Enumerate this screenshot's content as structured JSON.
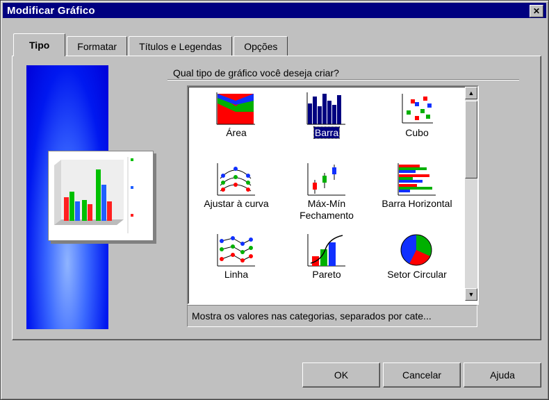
{
  "window": {
    "title": "Modificar Gráfico",
    "close_glyph": "✕"
  },
  "tabs": [
    {
      "label": "Tipo",
      "active": true
    },
    {
      "label": "Formatar",
      "active": false
    },
    {
      "label": "Títulos e Legendas",
      "active": false
    },
    {
      "label": "Opções",
      "active": false
    }
  ],
  "prompt": "Qual tipo de gráfico você deseja criar?",
  "chart_types": [
    {
      "label": "Área",
      "icon": "area-chart-icon",
      "selected": false
    },
    {
      "label": "Barra",
      "icon": "bar-chart-icon",
      "selected": true
    },
    {
      "label": "Cubo",
      "icon": "cube-chart-icon",
      "selected": false
    },
    {
      "label": "Ajustar à curva",
      "icon": "curve-fit-chart-icon",
      "selected": false
    },
    {
      "label": "Máx-Mín Fechamento",
      "label_line1": "Máx-Mín",
      "label_line2": "Fechamento",
      "icon": "high-low-close-chart-icon",
      "selected": false
    },
    {
      "label": "Barra Horizontal",
      "icon": "horizontal-bar-chart-icon",
      "selected": false
    },
    {
      "label": "Linha",
      "icon": "line-chart-icon",
      "selected": false
    },
    {
      "label": "Pareto",
      "icon": "pareto-chart-icon",
      "selected": false
    },
    {
      "label": "Setor Circular",
      "icon": "pie-chart-icon",
      "selected": false
    }
  ],
  "description": "Mostra os valores nas categorias, separados por cate...",
  "buttons": {
    "ok": "OK",
    "cancel": "Cancelar",
    "help": "Ajuda"
  },
  "colors": {
    "titlebar": "#000080",
    "selection": "#000080",
    "preview_bg": "#0018f0"
  }
}
